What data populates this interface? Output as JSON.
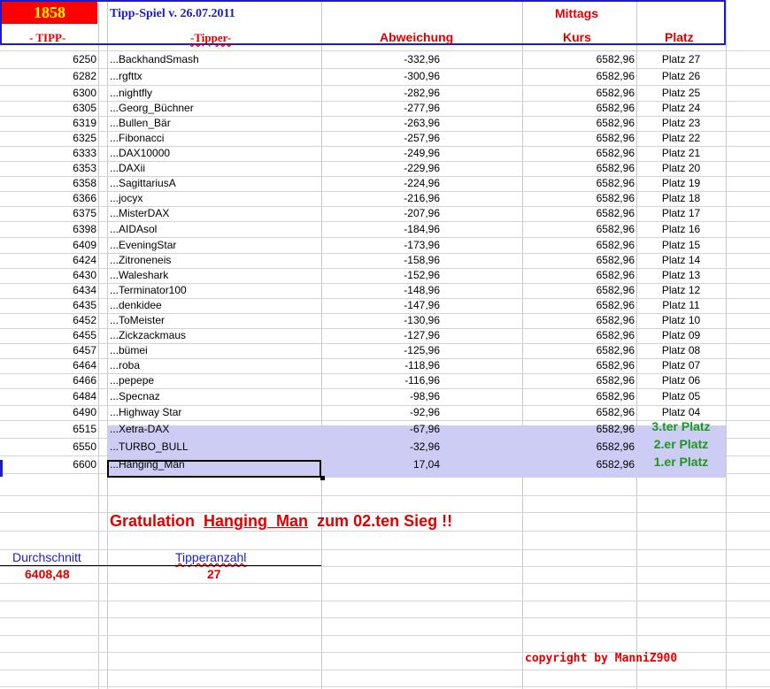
{
  "header": {
    "game_number": "1858",
    "title": "Tipp-Spiel v. 26.07.2011",
    "session": "Mittags",
    "col_tipp": "- TIPP-",
    "col_tipper": "-Tipper-",
    "col_abweichung": "Abweichung",
    "col_kurs": "Kurs",
    "col_platz": "Platz"
  },
  "rows": [
    {
      "tipp": "6250",
      "tipper": "...BackhandSmash",
      "abw": "-332,96",
      "kurs": "6582,96",
      "platz": "Platz 27"
    },
    {
      "tipp": "6282",
      "tipper": "...rgfttx",
      "abw": "-300,96",
      "kurs": "6582,96",
      "platz": "Platz 26"
    },
    {
      "tipp": "6300",
      "tipper": "...nightfly",
      "abw": "-282,96",
      "kurs": "6582,96",
      "platz": "Platz 25"
    },
    {
      "tipp": "6305",
      "tipper": "...Georg_Büchner",
      "abw": "-277,96",
      "kurs": "6582,96",
      "platz": "Platz 24"
    },
    {
      "tipp": "6319",
      "tipper": "...Bullen_Bär",
      "abw": "-263,96",
      "kurs": "6582,96",
      "platz": "Platz 23"
    },
    {
      "tipp": "6325",
      "tipper": "...Fibonacci",
      "abw": "-257,96",
      "kurs": "6582,96",
      "platz": "Platz 22"
    },
    {
      "tipp": "6333",
      "tipper": "...DAX10000",
      "abw": "-249,96",
      "kurs": "6582,96",
      "platz": "Platz 21"
    },
    {
      "tipp": "6353",
      "tipper": "...DAXii",
      "abw": "-229,96",
      "kurs": "6582,96",
      "platz": "Platz 20"
    },
    {
      "tipp": "6358",
      "tipper": "...SagittariusA",
      "abw": "-224,96",
      "kurs": "6582,96",
      "platz": "Platz 19"
    },
    {
      "tipp": "6366",
      "tipper": "...jocyx",
      "abw": "-216,96",
      "kurs": "6582,96",
      "platz": "Platz 18"
    },
    {
      "tipp": "6375",
      "tipper": "...MisterDAX",
      "abw": "-207,96",
      "kurs": "6582,96",
      "platz": "Platz 17"
    },
    {
      "tipp": "6398",
      "tipper": "...AIDAsol",
      "abw": "-184,96",
      "kurs": "6582,96",
      "platz": "Platz 16"
    },
    {
      "tipp": "6409",
      "tipper": "...EveningStar",
      "abw": "-173,96",
      "kurs": "6582,96",
      "platz": "Platz 15"
    },
    {
      "tipp": "6424",
      "tipper": "...Zitroneneis",
      "abw": "-158,96",
      "kurs": "6582,96",
      "platz": "Platz 14"
    },
    {
      "tipp": "6430",
      "tipper": "...Waleshark",
      "abw": "-152,96",
      "kurs": "6582,96",
      "platz": "Platz 13"
    },
    {
      "tipp": "6434",
      "tipper": "...Terminator100",
      "abw": "-148,96",
      "kurs": "6582,96",
      "platz": "Platz 12"
    },
    {
      "tipp": "6435",
      "tipper": "...denkidee",
      "abw": "-147,96",
      "kurs": "6582,96",
      "platz": "Platz 11"
    },
    {
      "tipp": "6452",
      "tipper": "...ToMeister",
      "abw": "-130,96",
      "kurs": "6582,96",
      "platz": "Platz 10"
    },
    {
      "tipp": "6455",
      "tipper": "...Zickzackmaus",
      "abw": "-127,96",
      "kurs": "6582,96",
      "platz": "Platz 09"
    },
    {
      "tipp": "6457",
      "tipper": "...bümei",
      "abw": "-125,96",
      "kurs": "6582,96",
      "platz": "Platz 08"
    },
    {
      "tipp": "6464",
      "tipper": "...roba",
      "abw": "-118,96",
      "kurs": "6582,96",
      "platz": "Platz 07"
    },
    {
      "tipp": "6466",
      "tipper": "...pepepe",
      "abw": "-116,96",
      "kurs": "6582,96",
      "platz": "Platz 06"
    },
    {
      "tipp": "6484",
      "tipper": "...Specnaz",
      "abw": "-98,96",
      "kurs": "6582,96",
      "platz": "Platz 05"
    },
    {
      "tipp": "6490",
      "tipper": "...Highway Star",
      "abw": "-92,96",
      "kurs": "6582,96",
      "platz": "Platz 04"
    },
    {
      "tipp": "6515",
      "tipper": "...Xetra-DAX",
      "abw": "-67,96",
      "kurs": "6582,96",
      "platz": "3.ter Platz"
    },
    {
      "tipp": "6550",
      "tipper": "...TURBO_BULL",
      "abw": "-32,96",
      "kurs": "6582,96",
      "platz": "2.er Platz"
    },
    {
      "tipp": "6600",
      "tipper": "...Hanging_Man",
      "abw": "17,04",
      "kurs": "6582,96",
      "platz": "1.er Platz"
    }
  ],
  "congrats": {
    "prefix": "Gratulation",
    "name": "Hanging_Man",
    "suffix": "zum  02.ten Sieg !!"
  },
  "stats": {
    "avg_label": "Durchschnitt",
    "avg_value": "6408,48",
    "count_label": "Tipperanzahl",
    "count_value": "27"
  },
  "footer": {
    "copyright": "copyright by ManniZ900"
  },
  "colors": {
    "accent_blue": "#1c1cc8",
    "red": "#e00000",
    "green": "#1a9a1a",
    "highlight": "#ccccf5"
  }
}
